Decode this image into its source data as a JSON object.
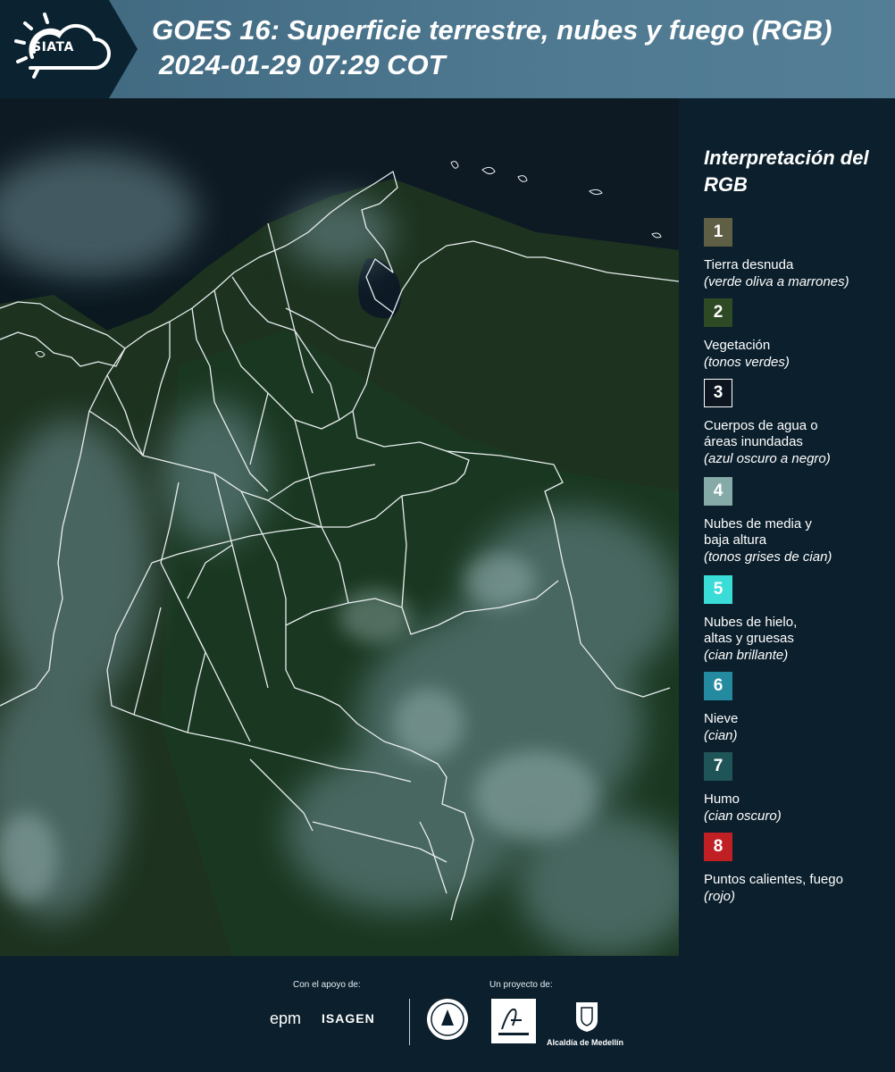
{
  "header": {
    "logo_text": "SIATA",
    "title_line1": "GOES 16: Superficie terrestre, nubes y fuego (RGB)",
    "title_line2": "2024-01-29 07:29 COT"
  },
  "legend": {
    "title": "Interpretación del RGB",
    "items": [
      {
        "num": "1",
        "label": "Tierra desnuda",
        "note": "(verde oliva a marrones)",
        "color": "#5f5f45"
      },
      {
        "num": "2",
        "label": "Vegetación",
        "note": "(tonos verdes)",
        "color": "#2e4a25"
      },
      {
        "num": "3",
        "label": "Cuerpos de agua o\náreas inundadas",
        "note": "(azul oscuro a negro)",
        "color": "#0d1620"
      },
      {
        "num": "4",
        "label": "Nubes de media y\nbaja altura",
        "note": "(tonos grises de cian)",
        "color": "#86aaa7"
      },
      {
        "num": "5",
        "label": "Nubes de hielo,\naltas y gruesas",
        "note": "(cian brillante)",
        "color": "#3adcd8"
      },
      {
        "num": "6",
        "label": "Nieve",
        "note": "(cian)",
        "color": "#238aa0"
      },
      {
        "num": "7",
        "label": "Humo",
        "note": "(cian oscuro)",
        "color": "#1f5458"
      },
      {
        "num": "8",
        "label": "Puntos calientes, fuego",
        "note": "(rojo)",
        "color": "#c01f24"
      }
    ]
  },
  "footer": {
    "support_label": "Con el apoyo de:",
    "project_label": "Un proyecto de:",
    "epm": "epm",
    "isagen": "ISAGEN",
    "alcaldia": "Alcaldía de Medellín"
  }
}
